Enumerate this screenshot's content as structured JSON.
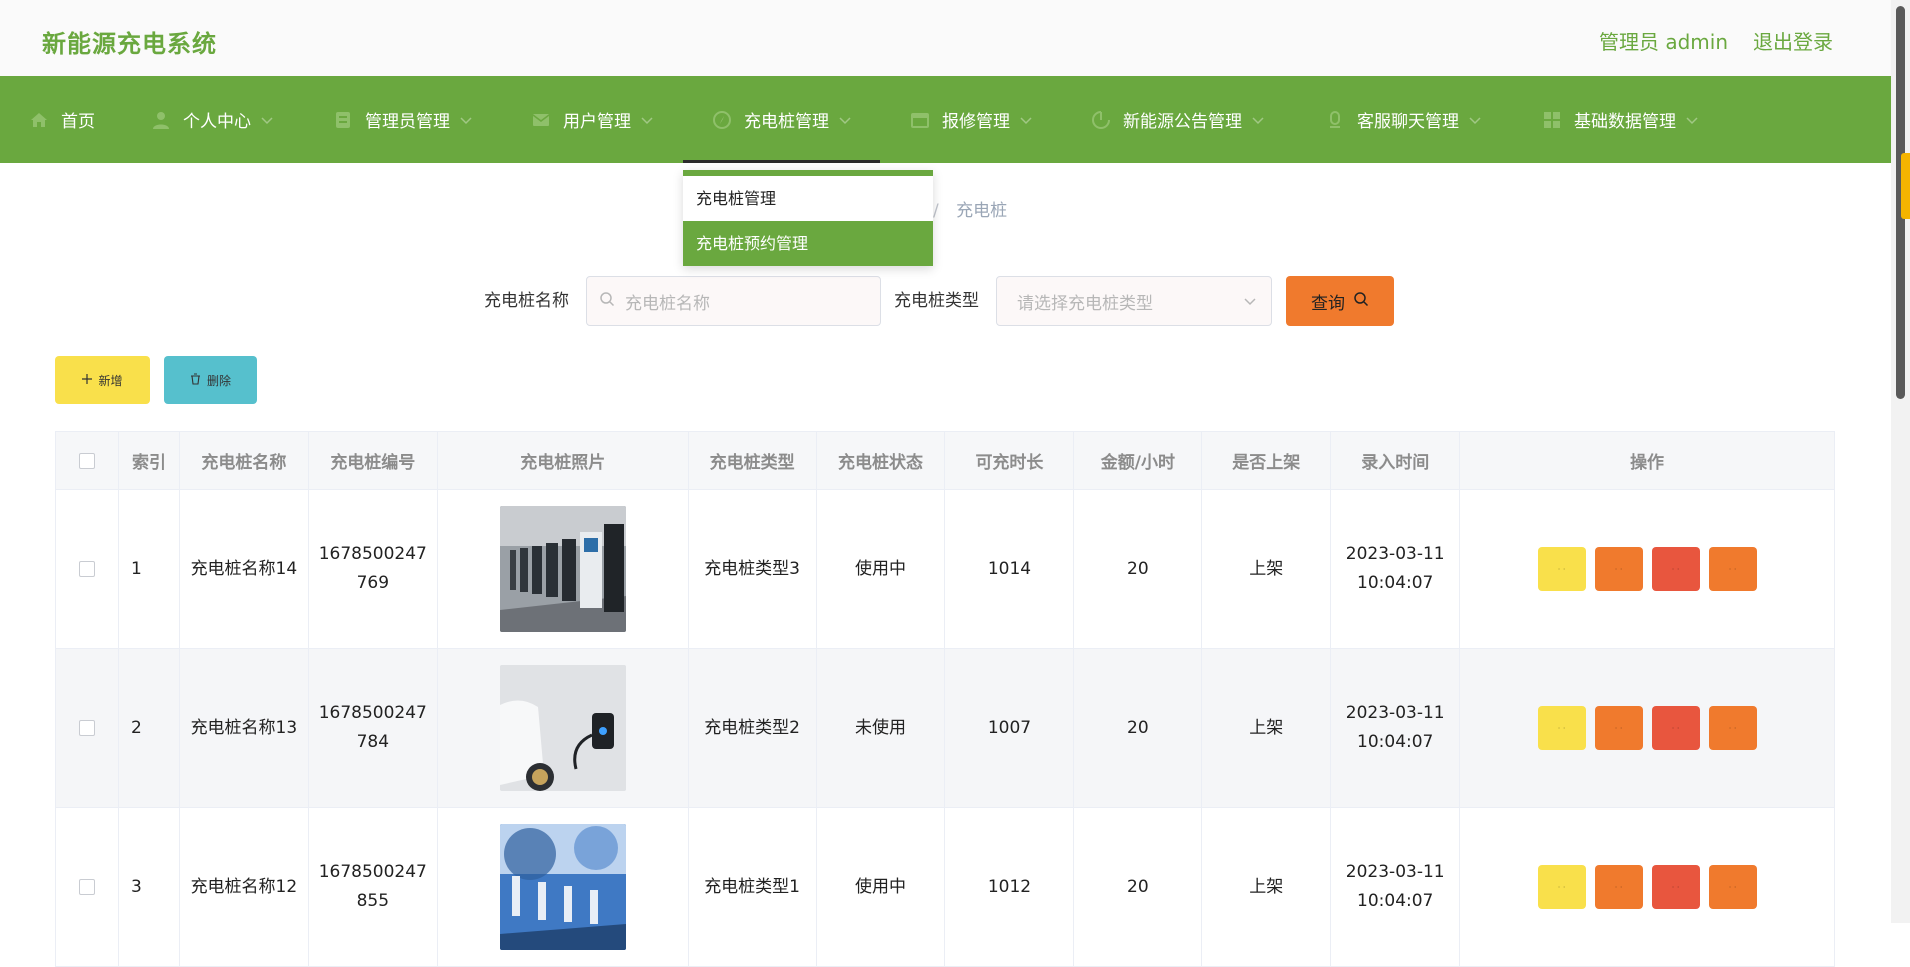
{
  "header": {
    "title": "新能源充电系统",
    "admin_label": "管理员 admin",
    "logout_label": "退出登录"
  },
  "nav": [
    {
      "label": "首页",
      "icon": "home-icon"
    },
    {
      "label": "个人中心",
      "icon": "user-icon"
    },
    {
      "label": "管理员管理",
      "icon": "admin-icon"
    },
    {
      "label": "用户管理",
      "icon": "mail-icon"
    },
    {
      "label": "充电桩管理",
      "icon": "compass-icon"
    },
    {
      "label": "报修管理",
      "icon": "repair-icon"
    },
    {
      "label": "新能源公告管理",
      "icon": "notice-icon"
    },
    {
      "label": "客服聊天管理",
      "icon": "chat-icon"
    },
    {
      "label": "基础数据管理",
      "icon": "grid-icon"
    }
  ],
  "dropdown": {
    "items": [
      "充电桩管理",
      "充电桩预约管理"
    ],
    "active_index": 1
  },
  "breadcrumb": {
    "separator": "/",
    "current": "充电桩"
  },
  "search": {
    "name_label": "充电桩名称",
    "name_placeholder": "充电桩名称",
    "type_label": "充电桩类型",
    "type_placeholder": "请选择充电桩类型",
    "query_label": "查询"
  },
  "actions": {
    "add_label": "新增",
    "delete_label": "删除"
  },
  "table": {
    "columns": [
      "索引",
      "充电桩名称",
      "充电桩编号",
      "充电桩照片",
      "充电桩类型",
      "充电桩状态",
      "可充时长",
      "金额/小时",
      "是否上架",
      "录入时间",
      "操作"
    ],
    "rows": [
      {
        "index": "1",
        "name": "充电桩名称14",
        "code": "1678500247769",
        "type": "充电桩类型3",
        "state": "使用中",
        "duration": "1014",
        "price": "20",
        "shelf": "上架",
        "time": "2023-03-11 10:04:07"
      },
      {
        "index": "2",
        "name": "充电桩名称13",
        "code": "1678500247784",
        "type": "充电桩类型2",
        "state": "未使用",
        "duration": "1007",
        "price": "20",
        "shelf": "上架",
        "time": "2023-03-11 10:04:07"
      },
      {
        "index": "3",
        "name": "充电桩名称12",
        "code": "1678500247855",
        "type": "充电桩类型1",
        "state": "使用中",
        "duration": "1012",
        "price": "20",
        "shelf": "上架",
        "time": "2023-03-11 10:04:07"
      }
    ]
  },
  "colors": {
    "primary": "#6aa83f",
    "warning": "#f9e04b",
    "orange": "#f07a2d",
    "danger": "#e8563e",
    "info": "#56c0cd"
  }
}
